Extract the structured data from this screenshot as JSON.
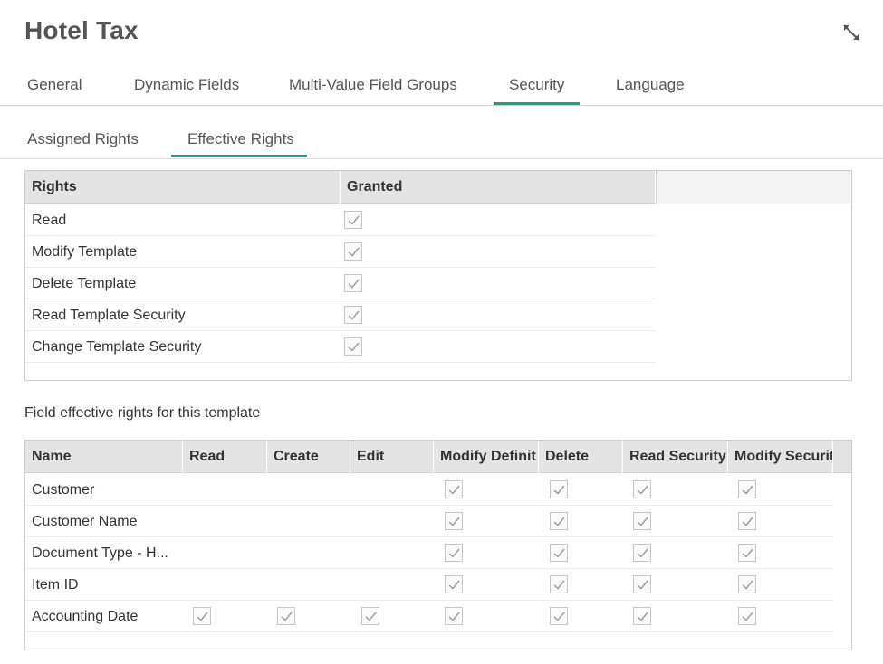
{
  "header": {
    "title": "Hotel Tax",
    "expand_icon": "expand-arrows-icon"
  },
  "tabs": [
    {
      "label": "General",
      "active": false
    },
    {
      "label": "Dynamic Fields",
      "active": false
    },
    {
      "label": "Multi-Value Field Groups",
      "active": false
    },
    {
      "label": "Security",
      "active": true
    },
    {
      "label": "Language",
      "active": false
    }
  ],
  "subtabs": [
    {
      "label": "Assigned Rights",
      "active": false
    },
    {
      "label": "Effective Rights",
      "active": true
    }
  ],
  "rights_table": {
    "columns": [
      "Rights",
      "Granted"
    ],
    "rows": [
      {
        "name": "Read",
        "granted": true
      },
      {
        "name": "Modify Template",
        "granted": true
      },
      {
        "name": "Delete Template",
        "granted": true
      },
      {
        "name": "Read Template Security",
        "granted": true
      },
      {
        "name": "Change Template Security",
        "granted": true
      }
    ]
  },
  "field_rights": {
    "caption": "Field effective rights for this template",
    "columns": [
      "Name",
      "Read",
      "Create",
      "Edit",
      "Modify Definit",
      "Delete",
      "Read Security",
      "Modify Securit"
    ],
    "rows": [
      {
        "name": "Customer",
        "checks": [
          false,
          false,
          false,
          true,
          true,
          true,
          true
        ]
      },
      {
        "name": "Customer Name",
        "checks": [
          false,
          false,
          false,
          true,
          true,
          true,
          true
        ]
      },
      {
        "name": "Document Type - H...",
        "checks": [
          false,
          false,
          false,
          true,
          true,
          true,
          true
        ]
      },
      {
        "name": "Item ID",
        "checks": [
          false,
          false,
          false,
          true,
          true,
          true,
          true
        ]
      },
      {
        "name": "Accounting Date",
        "checks": [
          true,
          true,
          true,
          true,
          true,
          true,
          true
        ]
      }
    ]
  },
  "colors": {
    "accent": "#15a589",
    "header_bg": "#e4e4e4"
  }
}
